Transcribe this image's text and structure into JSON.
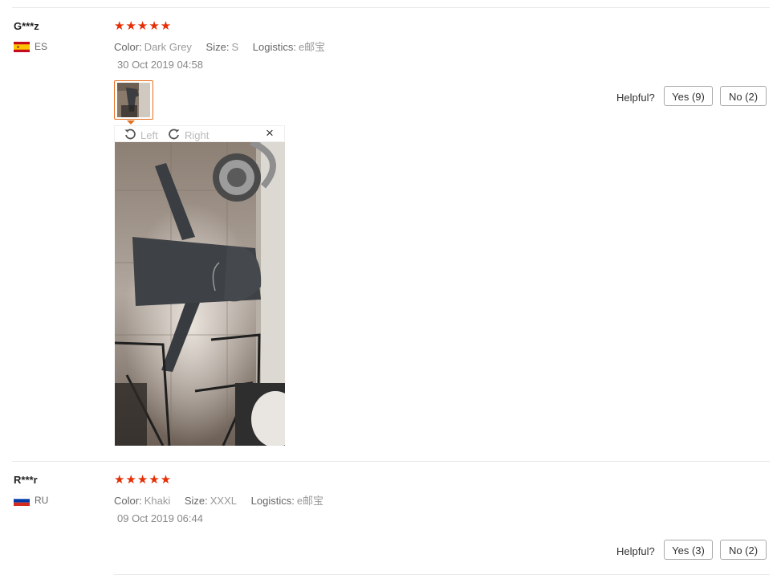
{
  "reviews": [
    {
      "user": "G***z",
      "country": "ES",
      "stars": "★★★★★",
      "color_label": "Color:",
      "color_value": "Dark Grey",
      "size_label": "Size:",
      "size_value": "S",
      "logistics_label": "Logistics:",
      "logistics_value": "e邮宝",
      "date": "30 Oct 2019 04:58",
      "helpful_label": "Helpful?",
      "yes_label": "Yes (9)",
      "no_label": "No (2)",
      "viewer": {
        "left_label": "Left",
        "right_label": "Right",
        "close_label": "×"
      }
    },
    {
      "user": "R***r",
      "country": "RU",
      "stars": "★★★★★",
      "color_label": "Color:",
      "color_value": "Khaki",
      "size_label": "Size:",
      "size_value": "XXXL",
      "logistics_label": "Logistics:",
      "logistics_value": "e邮宝",
      "date": "09 Oct 2019 06:44",
      "helpful_label": "Helpful?",
      "yes_label": "Yes (3)",
      "no_label": "No (2)"
    }
  ],
  "colors": {
    "star": "#e62e04",
    "thumb_border": "#e46f1f"
  }
}
